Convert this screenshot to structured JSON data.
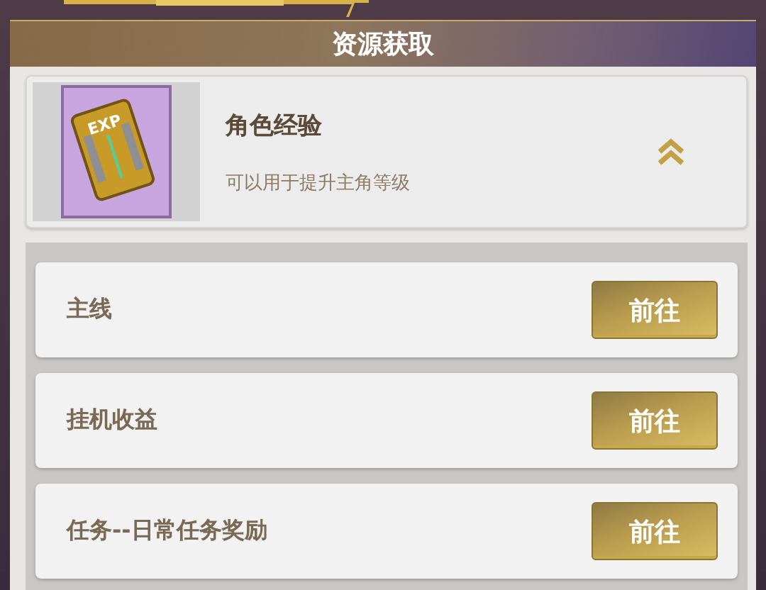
{
  "header": {
    "title": "资源获取"
  },
  "item": {
    "name": "角色经验",
    "description": "可以用于提升主角等级",
    "icon_label": "EXP",
    "expanded": true
  },
  "sources": [
    {
      "label": "主线",
      "button": "前往"
    },
    {
      "label": "挂机收益",
      "button": "前往"
    },
    {
      "label": "任务--日常任务奖励",
      "button": "前往"
    }
  ]
}
